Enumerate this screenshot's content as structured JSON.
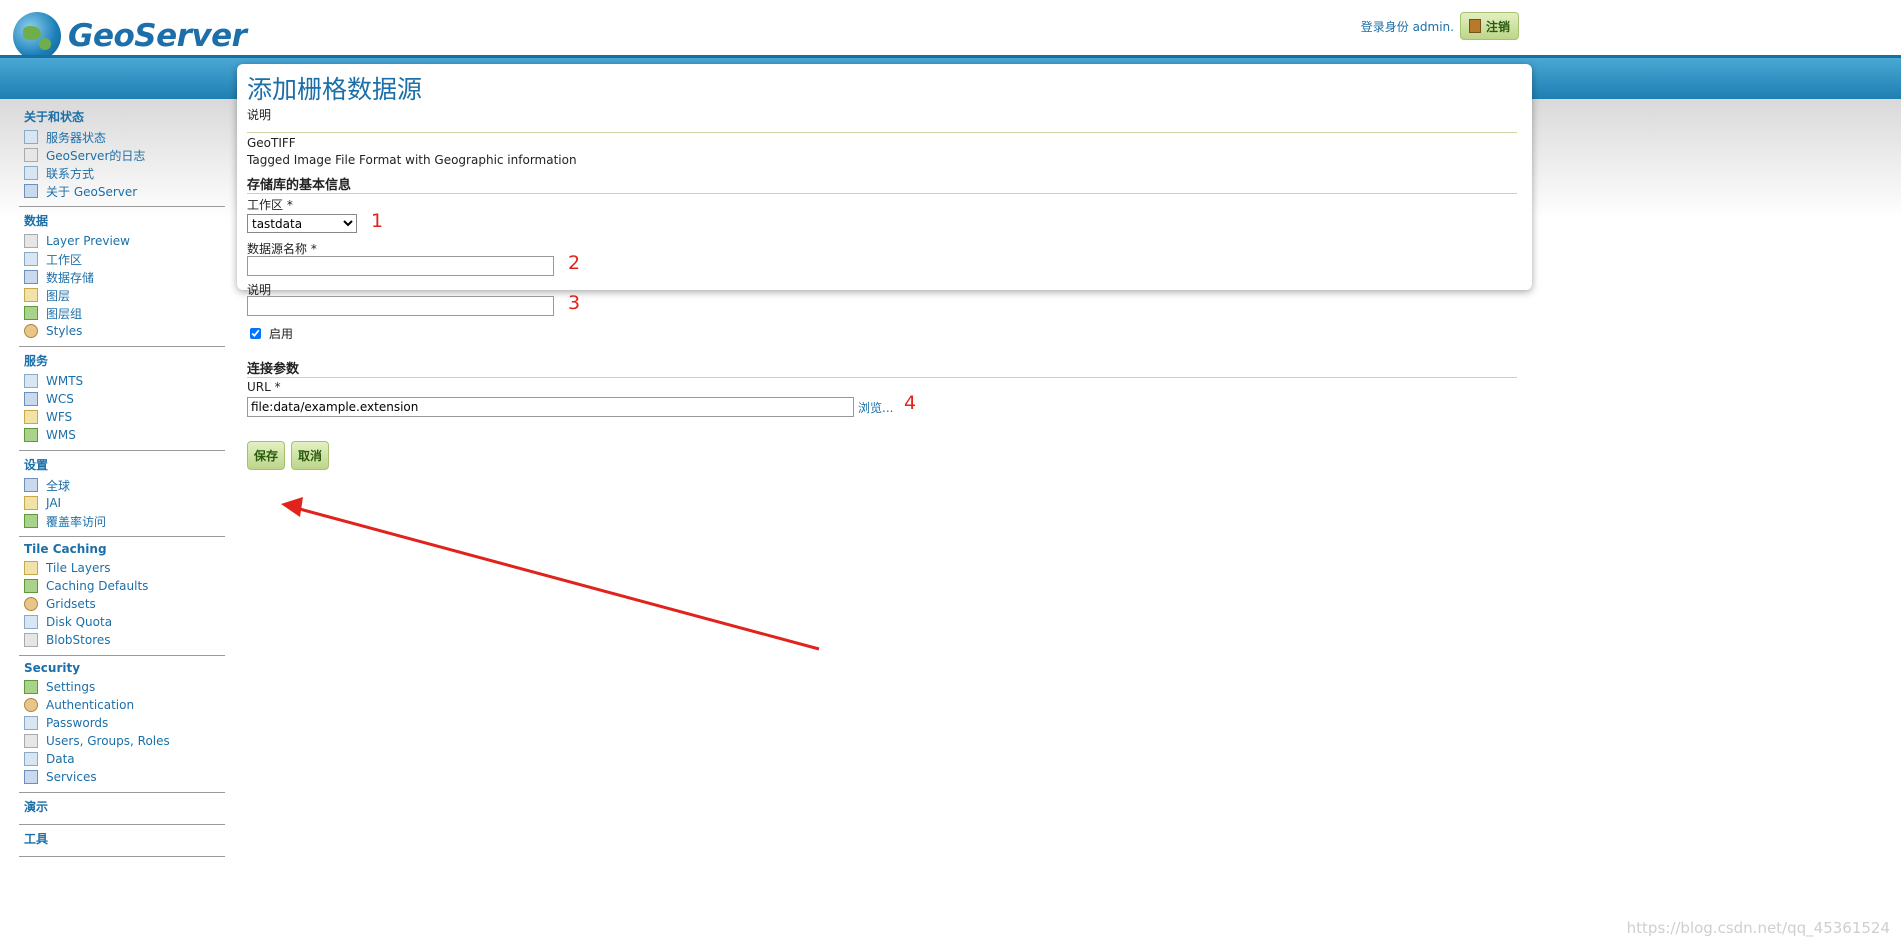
{
  "header": {
    "logo_text": "GeoServer",
    "login_text": "登录身份 admin.",
    "logout_label": "注销"
  },
  "sidebar": {
    "sections": [
      {
        "title": "关于和状态",
        "items": [
          {
            "label": "服务器状态",
            "icon": "server-status-icon"
          },
          {
            "label": "GeoServer的日志",
            "icon": "log-icon"
          },
          {
            "label": "联系方式",
            "icon": "contact-icon"
          },
          {
            "label": "关于 GeoServer",
            "icon": "about-icon"
          }
        ]
      },
      {
        "title": "数据",
        "items": [
          {
            "label": "Layer Preview",
            "icon": "layer-preview-icon"
          },
          {
            "label": "工作区",
            "icon": "folder-icon"
          },
          {
            "label": "数据存储",
            "icon": "datastore-icon"
          },
          {
            "label": "图层",
            "icon": "layers-icon"
          },
          {
            "label": "图层组",
            "icon": "layer-group-icon"
          },
          {
            "label": "Styles",
            "icon": "palette-icon"
          }
        ]
      },
      {
        "title": "服务",
        "items": [
          {
            "label": "WMTS",
            "icon": "service-icon"
          },
          {
            "label": "WCS",
            "icon": "service-icon"
          },
          {
            "label": "WFS",
            "icon": "service-icon"
          },
          {
            "label": "WMS",
            "icon": "service-icon"
          }
        ]
      },
      {
        "title": "设置",
        "items": [
          {
            "label": "全球",
            "icon": "settings-icon"
          },
          {
            "label": "JAI",
            "icon": "jai-icon"
          },
          {
            "label": "覆盖率访问",
            "icon": "coverage-access-icon"
          }
        ]
      },
      {
        "title": "Tile Caching",
        "items": [
          {
            "label": "Tile Layers",
            "icon": "tile-layers-icon"
          },
          {
            "label": "Caching Defaults",
            "icon": "globe-icon"
          },
          {
            "label": "Gridsets",
            "icon": "grid-icon"
          },
          {
            "label": "Disk Quota",
            "icon": "disk-icon"
          },
          {
            "label": "BlobStores",
            "icon": "blobstore-icon"
          }
        ]
      },
      {
        "title": "Security",
        "items": [
          {
            "label": "Settings",
            "icon": "wrench-icon"
          },
          {
            "label": "Authentication",
            "icon": "shield-icon"
          },
          {
            "label": "Passwords",
            "icon": "lock-icon"
          },
          {
            "label": "Users, Groups, Roles",
            "icon": "users-icon"
          },
          {
            "label": "Data",
            "icon": "data-security-icon"
          },
          {
            "label": "Services",
            "icon": "services-security-icon"
          }
        ]
      },
      {
        "title": "演示",
        "items": []
      },
      {
        "title": "工具",
        "items": []
      }
    ]
  },
  "main": {
    "title": "添加栅格数据源",
    "description_label": "说明",
    "type_name": "GeoTIFF",
    "type_description": "Tagged Image File Format with Geographic information",
    "basic_section": "存储库的基本信息",
    "workspace_label": "工作区 *",
    "workspace_value": "tastdata",
    "name_label": "数据源名称 *",
    "name_value": "",
    "desc_label": "说明",
    "desc_value": "",
    "enabled_label": "启用",
    "enabled": true,
    "conn_section": "连接参数",
    "url_label": "URL *",
    "url_value": "file:data/example.extension",
    "browse_label": "浏览...",
    "save_label": "保存",
    "cancel_label": "取消"
  },
  "annotations": [
    "1",
    "2",
    "3",
    "4"
  ],
  "watermark": "https://blog.csdn.net/qq_45361524",
  "colors": {
    "link_blue": "#1c6fa8",
    "annotation_red": "#e0231c",
    "header_blue": "#1f7fb3"
  }
}
